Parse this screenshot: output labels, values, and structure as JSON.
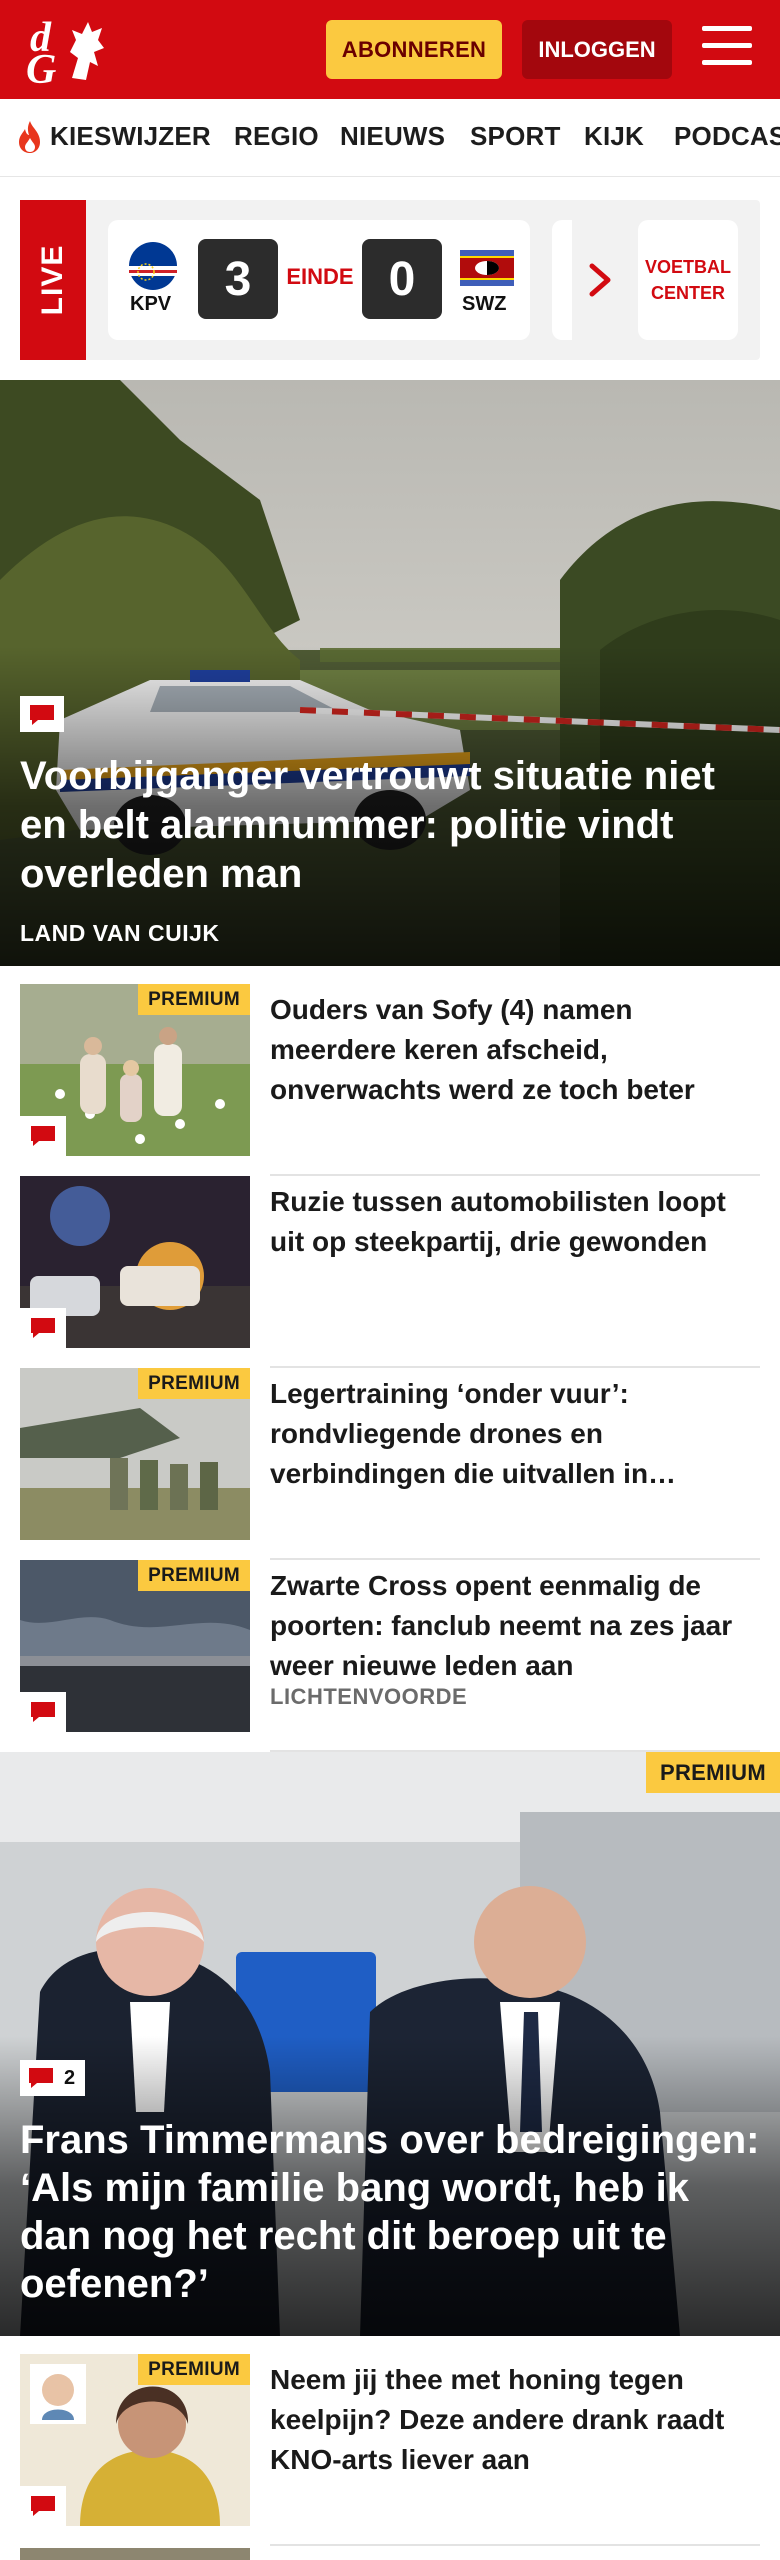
{
  "header": {
    "logo_letters": [
      "d",
      "G"
    ],
    "subscribe_label": "ABONNEREN",
    "login_label": "INLOGGEN",
    "brand_color": "#d20a11",
    "accent_color": "#fbc940"
  },
  "nav": {
    "items": [
      "KIESWIJZER",
      "REGIO",
      "NIEUWS",
      "SPORT",
      "KIJK",
      "PODCAST"
    ]
  },
  "live": {
    "label": "LIVE",
    "home_team": "KPV",
    "home_score": "3",
    "status": "EINDE",
    "away_score": "0",
    "away_team": "SWZ",
    "center_label": "VOETBAL CENTER"
  },
  "hero": {
    "title": "Voorbijganger vertrouwt situatie niet en belt alarmnummer: politie vindt overleden man",
    "kicker": "LAND VAN CUIJK"
  },
  "articles": [
    {
      "title": "Ouders van Sofy (4) namen meerdere keren afscheid, onverwachts werd ze toch beter",
      "premium": "PREMIUM",
      "kicker": ""
    },
    {
      "title": "Ruzie tussen automobilisten loopt uit op steekpartij, drie gewonden",
      "premium": "",
      "kicker": ""
    },
    {
      "title": "Legertraining ‘onder vuur’: rondvliegende drones en verbindingen die uitvallen in…",
      "premium": "PREMIUM",
      "kicker": ""
    },
    {
      "title": "Zwarte Cross opent eenmalig de poorten: fanclub neemt na zes jaar weer nieuwe leden aan",
      "premium": "PREMIUM",
      "kicker": "LICHTENVOORDE"
    }
  ],
  "feature": {
    "premium": "PREMIUM",
    "comment_count": "2",
    "title": "Frans Timmermans over bedreigingen: ‘Als mijn familie bang wordt, heb ik dan nog het recht dit beroep uit te oefenen?’"
  },
  "articles_after": [
    {
      "title": "Neem jij thee met honing tegen keelpijn? Deze andere drank raadt KNO-arts liever aan",
      "premium": "PREMIUM"
    }
  ]
}
